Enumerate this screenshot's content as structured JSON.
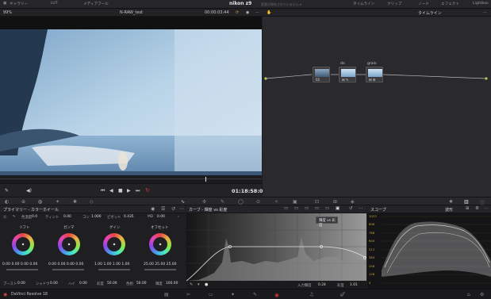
{
  "topbar": {
    "media_pool": "ギャラリー",
    "lut": "LUT",
    "media_pool2": "メディアプール",
    "project_title": "nikon z9",
    "saved_status": "変更が保存されていません ▾",
    "timeline": "タイムライン",
    "clips": "クリップ",
    "nodes": "ノード",
    "effects": "エフェクト",
    "lightbox": "Lightbox"
  },
  "viewer": {
    "zoom": "99%",
    "clip_name": "N-RAW_test",
    "timecode_top": "00:00:03:44",
    "timecode": "01:18:58:09"
  },
  "node_editor": {
    "mode": "タイムライン",
    "node1_label": "01",
    "node2_label": "dn",
    "node3_label": "grain"
  },
  "wheels": {
    "title": "プライマリー - カラーホイール",
    "contrast_label": "コントラスト",
    "contrast_value": "0.0",
    "pivot_label": "ピボット",
    "pivot_value": "0.435",
    "temp_label": "色温度",
    "temp_value": "0.0",
    "tint_label": "ティント",
    "tint_value": "0.00",
    "md_label": "MD",
    "md_value": "0.00",
    "con_label": "コン",
    "con_value": "1.000",
    "items": [
      {
        "title": "リフト",
        "values": "0.00  0.00  0.00  0.00"
      },
      {
        "title": "ガンマ",
        "values": "0.00  0.00  0.00  0.00"
      },
      {
        "title": "ゲイン",
        "values": "1.00  1.00  1.00  1.00"
      },
      {
        "title": "オフセット",
        "values": "25.00  25.00  25.00"
      }
    ],
    "bottom": {
      "boost_label": "ブースト",
      "boost_value": "0.00",
      "shadow_label": "シャドウ",
      "shadow_value": "0.00",
      "highlight_label": "ハイ",
      "highlight_value": "0.00",
      "sat_label": "彩度",
      "sat_value": "50.00",
      "hue_label": "色相",
      "hue_value": "50.00",
      "lum_label": "輝度",
      "lum_value": "100.00"
    }
  },
  "curves": {
    "title": "カーブ - 輝度 vs 彩度",
    "tooltip": "輝度 vs 彩度",
    "input_label": "入力輝度",
    "input_value": "0.24",
    "sat_label": "彩度",
    "sat_value": "1.01"
  },
  "scope": {
    "title": "スコープ",
    "mode": "波形",
    "scale": [
      "1023",
      "896",
      "768",
      "640",
      "512",
      "384",
      "256",
      "128",
      "0"
    ]
  },
  "status": {
    "app": "DaVinci Resolve 18"
  },
  "colors": {
    "accent": "#d3363a",
    "panel": "#1f1f22"
  }
}
